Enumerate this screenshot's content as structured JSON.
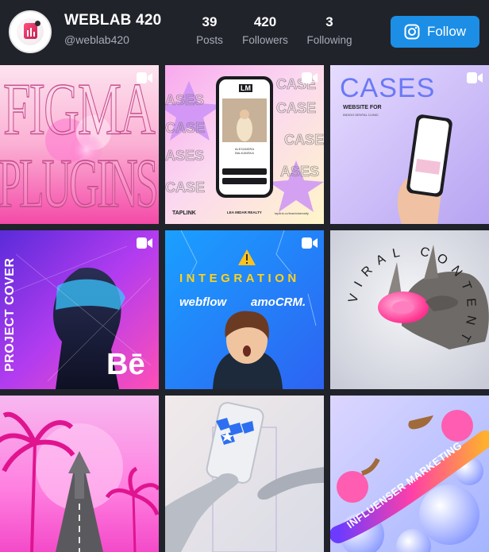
{
  "profile": {
    "name": "WEBLAB 420",
    "handle": "@weblab420"
  },
  "stats": [
    {
      "value": "39",
      "label": "Posts"
    },
    {
      "value": "420",
      "label": "Followers"
    },
    {
      "value": "3",
      "label": "Following"
    }
  ],
  "follow_button": {
    "label": "Follow",
    "icon": "instagram-icon",
    "color": "#1c8ee6"
  },
  "posts": [
    {
      "type": "video",
      "big_text_1": "FIGMA",
      "big_text_2": "PLUGINS"
    },
    {
      "type": "video",
      "phone_logo": "LM",
      "phone_title": "ALEXANDRA\nBALKANSKA",
      "repeat_word": "CASES",
      "footer_left": "TAPLINK",
      "footer_center": "LEA MIDAR REALTY",
      "footer_right": "taplink.cc/leamidarrealty"
    },
    {
      "type": "video",
      "title": "CASES",
      "subtitle": "WEBSITE FOR",
      "subtitle_small": "INDIGO DENTAL CLINIC"
    },
    {
      "type": "video",
      "side_text": "PROJECT COVER",
      "logo": "Bē"
    },
    {
      "type": "video",
      "title": "INTEGRATION",
      "logo_1": "webflow",
      "logo_2": "amoCRM."
    },
    {
      "type": "image",
      "title": "VIRAL CONTENT"
    },
    {
      "type": "image"
    },
    {
      "type": "image"
    },
    {
      "type": "image",
      "ribbon_text": "INFLUENSER MARKETING"
    }
  ],
  "colors": {
    "background": "#21232b",
    "accent": "#1c8ee6",
    "muted_text": "#a8abb5"
  }
}
